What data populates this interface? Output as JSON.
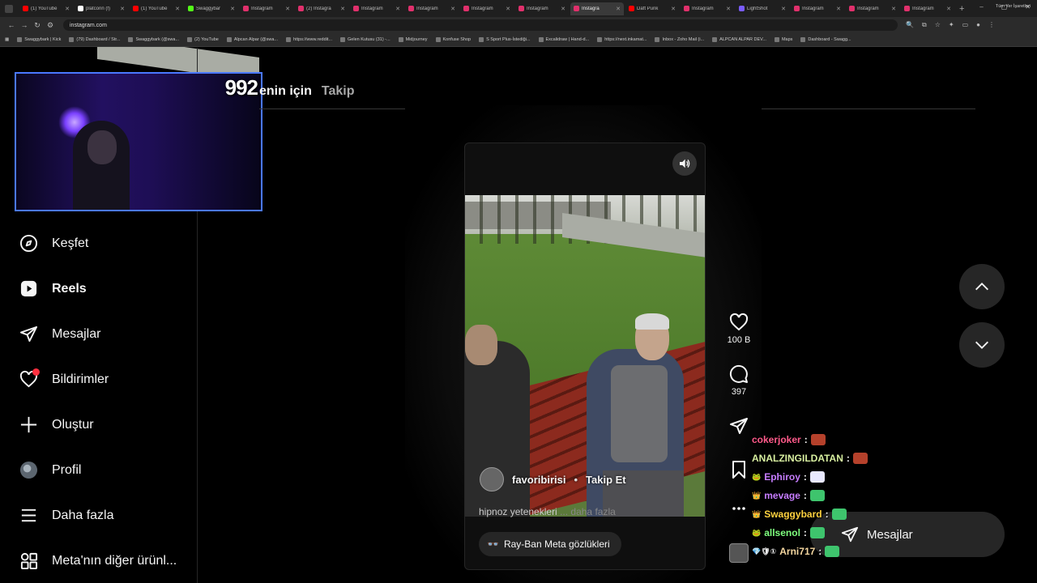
{
  "browser": {
    "tabs": [
      {
        "label": "(1) YouTube",
        "color": "#ff0000"
      },
      {
        "label": "platconn (f)",
        "color": "#ffffff"
      },
      {
        "label": "(1) YouTube",
        "color": "#ff0000"
      },
      {
        "label": "Swaggybar",
        "color": "#53fc18"
      },
      {
        "label": "Instagram",
        "color": "#e1306c"
      },
      {
        "label": "(2) Instagra",
        "color": "#e1306c"
      },
      {
        "label": "Instagram",
        "color": "#e1306c"
      },
      {
        "label": "Instagram",
        "color": "#e1306c"
      },
      {
        "label": "Instagram",
        "color": "#e1306c"
      },
      {
        "label": "Instagram",
        "color": "#e1306c"
      },
      {
        "label": "Instagra",
        "color": "#e1306c",
        "active": true
      },
      {
        "label": "Daft Punk",
        "color": "#ff0000"
      },
      {
        "label": "Instagram",
        "color": "#e1306c"
      },
      {
        "label": "LightShot",
        "color": "#7a5cff"
      },
      {
        "label": "Instagram",
        "color": "#e1306c"
      },
      {
        "label": "Instagram",
        "color": "#e1306c"
      },
      {
        "label": "Instagram",
        "color": "#e1306c"
      }
    ],
    "url_host": "instagram.com",
    "url_path": "/reels/DRP5dC5jHUJ/",
    "bookmarks": [
      "Swaggybark | Kick",
      "(79) Dashboard / Str...",
      "Swaggybark (@swa...",
      "(2) YouTube",
      "Alpcan Alpar (@swa...",
      "https://www.reddit...",
      "Gelen Kutusu (31) -...",
      "Midjourney",
      "Konfuse Shop",
      "S Sport Plus-İstediği...",
      "Excalidraw | Hand-d...",
      "https://next.inkamat...",
      "Inbox - Zoho Mail (i...",
      "ALPCAN ALPAR DEV...",
      "Maps",
      "Dashboard - Swagg..."
    ],
    "bookmarks_right": "Tüm Yer İşaretleri"
  },
  "webcam": {
    "counter": "992"
  },
  "sidebar": {
    "items": [
      {
        "label": "Keşfet",
        "icon": "compass-icon"
      },
      {
        "label": "Reels",
        "icon": "reels-icon",
        "active": true
      },
      {
        "label": "Mesajlar",
        "icon": "send-icon"
      },
      {
        "label": "Bildirimler",
        "icon": "heart-icon",
        "has_dot": true
      },
      {
        "label": "Oluştur",
        "icon": "plus-icon"
      },
      {
        "label": "Profil",
        "icon": "avatar"
      },
      {
        "label": "Daha fazla",
        "icon": "menu-icon"
      },
      {
        "label": "Meta'nın diğer ürünl...",
        "icon": "grid-icon"
      }
    ]
  },
  "feed": {
    "tab_for_you": "enin için",
    "tab_following": "Takip"
  },
  "reel": {
    "author": "favoribirisi",
    "separator": "•",
    "follow_label": "Takip Et",
    "caption": "hipnoz yetenekleri",
    "caption_more": "... daha fazla",
    "product_tag": "Ray-Ban Meta gözlükleri",
    "product_icon": "👓",
    "likes": "100 B",
    "comments": "397"
  },
  "chat": [
    {
      "user": "cokerjoker",
      "color": "#ff5a8a",
      "badge": "",
      "emote_color": "#b5412b"
    },
    {
      "user": "ANALZINGILDATAN",
      "color": "#d8f0a0",
      "badge": "",
      "emote_color": "#b5412b"
    },
    {
      "user": "Ephiroy",
      "color": "#c77dff",
      "badge": "🐸",
      "emote_color": "#e8e8ff"
    },
    {
      "user": "mevage",
      "color": "#c77dff",
      "badge": "👑",
      "emote_color": "#3ec46d"
    },
    {
      "user": "Swaggybard",
      "color": "#ffd23f",
      "badge": "👑",
      "emote_color": "#3ec46d"
    },
    {
      "user": "allsenol",
      "color": "#7fff7f",
      "badge": "🐸",
      "emote_color": "#3ec46d"
    },
    {
      "user": "Arni717",
      "color": "#f5d7a0",
      "badge": "💎🛡①",
      "emote_color": "#3ec46d"
    }
  ],
  "messages_button": {
    "label": "Mesajlar"
  }
}
